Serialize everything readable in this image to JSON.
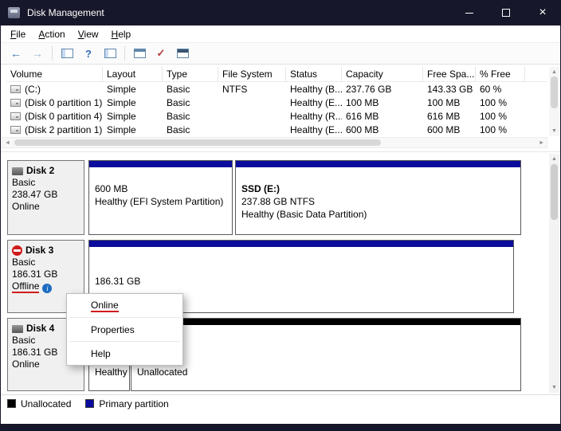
{
  "window": {
    "title": "Disk Management"
  },
  "menubar": {
    "items": [
      "File",
      "Action",
      "View",
      "Help"
    ]
  },
  "toolbar": {
    "icons": [
      "back-icon",
      "forward-icon",
      "console-tree-icon",
      "help-icon",
      "action-pane-icon",
      "dialog-icon",
      "check-icon",
      "properties-icon"
    ]
  },
  "volume_list": {
    "columns": [
      "Volume",
      "Layout",
      "Type",
      "File System",
      "Status",
      "Capacity",
      "Free Spa...",
      "% Free"
    ],
    "rows": [
      {
        "volume": "(C:)",
        "layout": "Simple",
        "type": "Basic",
        "file_system": "NTFS",
        "status": "Healthy (B...",
        "capacity": "237.76 GB",
        "free_space": "143.33 GB",
        "pct_free": "60 %"
      },
      {
        "volume": "(Disk 0 partition 1)",
        "layout": "Simple",
        "type": "Basic",
        "file_system": "",
        "status": "Healthy (E...",
        "capacity": "100 MB",
        "free_space": "100 MB",
        "pct_free": "100 %"
      },
      {
        "volume": "(Disk 0 partition 4)",
        "layout": "Simple",
        "type": "Basic",
        "file_system": "",
        "status": "Healthy (R...",
        "capacity": "616 MB",
        "free_space": "616 MB",
        "pct_free": "100 %"
      },
      {
        "volume": "(Disk 2 partition 1)",
        "layout": "Simple",
        "type": "Basic",
        "file_system": "",
        "status": "Healthy (E...",
        "capacity": "600 MB",
        "free_space": "600 MB",
        "pct_free": "100 %"
      }
    ]
  },
  "disks": [
    {
      "name": "Disk 2",
      "kind": "Basic",
      "size": "238.47 GB",
      "state": "Online",
      "partitions": [
        {
          "kind": "primary",
          "lines": [
            "600 MB",
            "Healthy (EFI System Partition)"
          ]
        },
        {
          "kind": "primary",
          "lines": [
            "SSD  (E:)",
            "237.88 GB NTFS",
            "Healthy (Basic Data Partition)"
          ]
        }
      ]
    },
    {
      "name": "Disk 3",
      "kind": "Basic",
      "size": "186.31 GB",
      "state": "Offline",
      "partitions": [
        {
          "kind": "primary",
          "lines": [
            "",
            "186.31 GB"
          ]
        }
      ]
    },
    {
      "name": "Disk 4",
      "kind": "Basic",
      "size": "186.31 GB",
      "state": "Online",
      "partitions": [
        {
          "kind": "primary",
          "lines": [
            "",
            "",
            "Healthy"
          ]
        },
        {
          "kind": "unallocated",
          "lines": [
            "",
            "",
            "Unallocated"
          ]
        }
      ]
    }
  ],
  "context_menu": {
    "items": [
      "Online",
      "Properties",
      "Help"
    ]
  },
  "legend": {
    "items": [
      {
        "label": "Unallocated",
        "color": "#000000"
      },
      {
        "label": "Primary partition",
        "color": "#0b0b9c"
      }
    ]
  },
  "colors": {
    "titlebar": "#17172b",
    "primary_partition": "#0b0b9c",
    "unallocated": "#000000",
    "annotation_red": "#cf1b1b",
    "offline_icon_red": "#cf1b1b",
    "info_icon_blue": "#1d6cc0"
  }
}
